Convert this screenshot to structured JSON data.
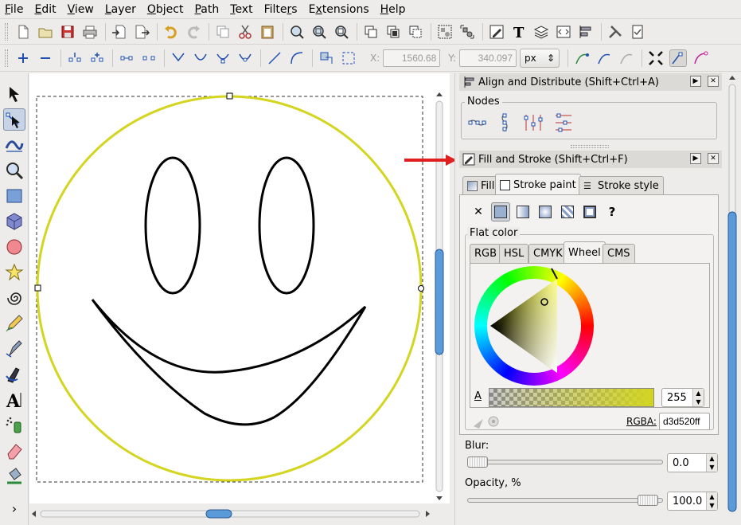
{
  "menu": [
    "File",
    "Edit",
    "View",
    "Layer",
    "Object",
    "Path",
    "Text",
    "Filters",
    "Extensions",
    "Help"
  ],
  "menu_mnemonic": [
    "F",
    "E",
    "V",
    "L",
    "O",
    "P",
    "T",
    "r",
    "x",
    "H"
  ],
  "coords": {
    "x_label": "X:",
    "x_value": "1560.68",
    "y_label": "Y:",
    "y_value": "340.097",
    "unit": "px"
  },
  "align_panel": {
    "title": "Align and Distribute (Shift+Ctrl+A)",
    "section": "Nodes"
  },
  "fill_panel": {
    "title": "Fill and Stroke (Shift+Ctrl+F)",
    "tabs": [
      "Fill",
      "Stroke paint",
      "Stroke style"
    ],
    "active_tab": "Stroke paint",
    "flat_color_label": "Flat color",
    "color_tabs": [
      "RGB",
      "HSL",
      "CMYK",
      "Wheel",
      "CMS"
    ],
    "active_color_tab": "Wheel",
    "alpha_label": "A",
    "alpha_value": "255",
    "rgba_label": "RGBA:",
    "rgba_value": "d3d520ff",
    "blur_label": "Blur:",
    "blur_value": "0.0",
    "opacity_label": "Opacity, %",
    "opacity_value": "100.0"
  },
  "colors": {
    "stroke": "#d3d520",
    "accent": "#4a7fd6",
    "arrow": "#e02020"
  }
}
